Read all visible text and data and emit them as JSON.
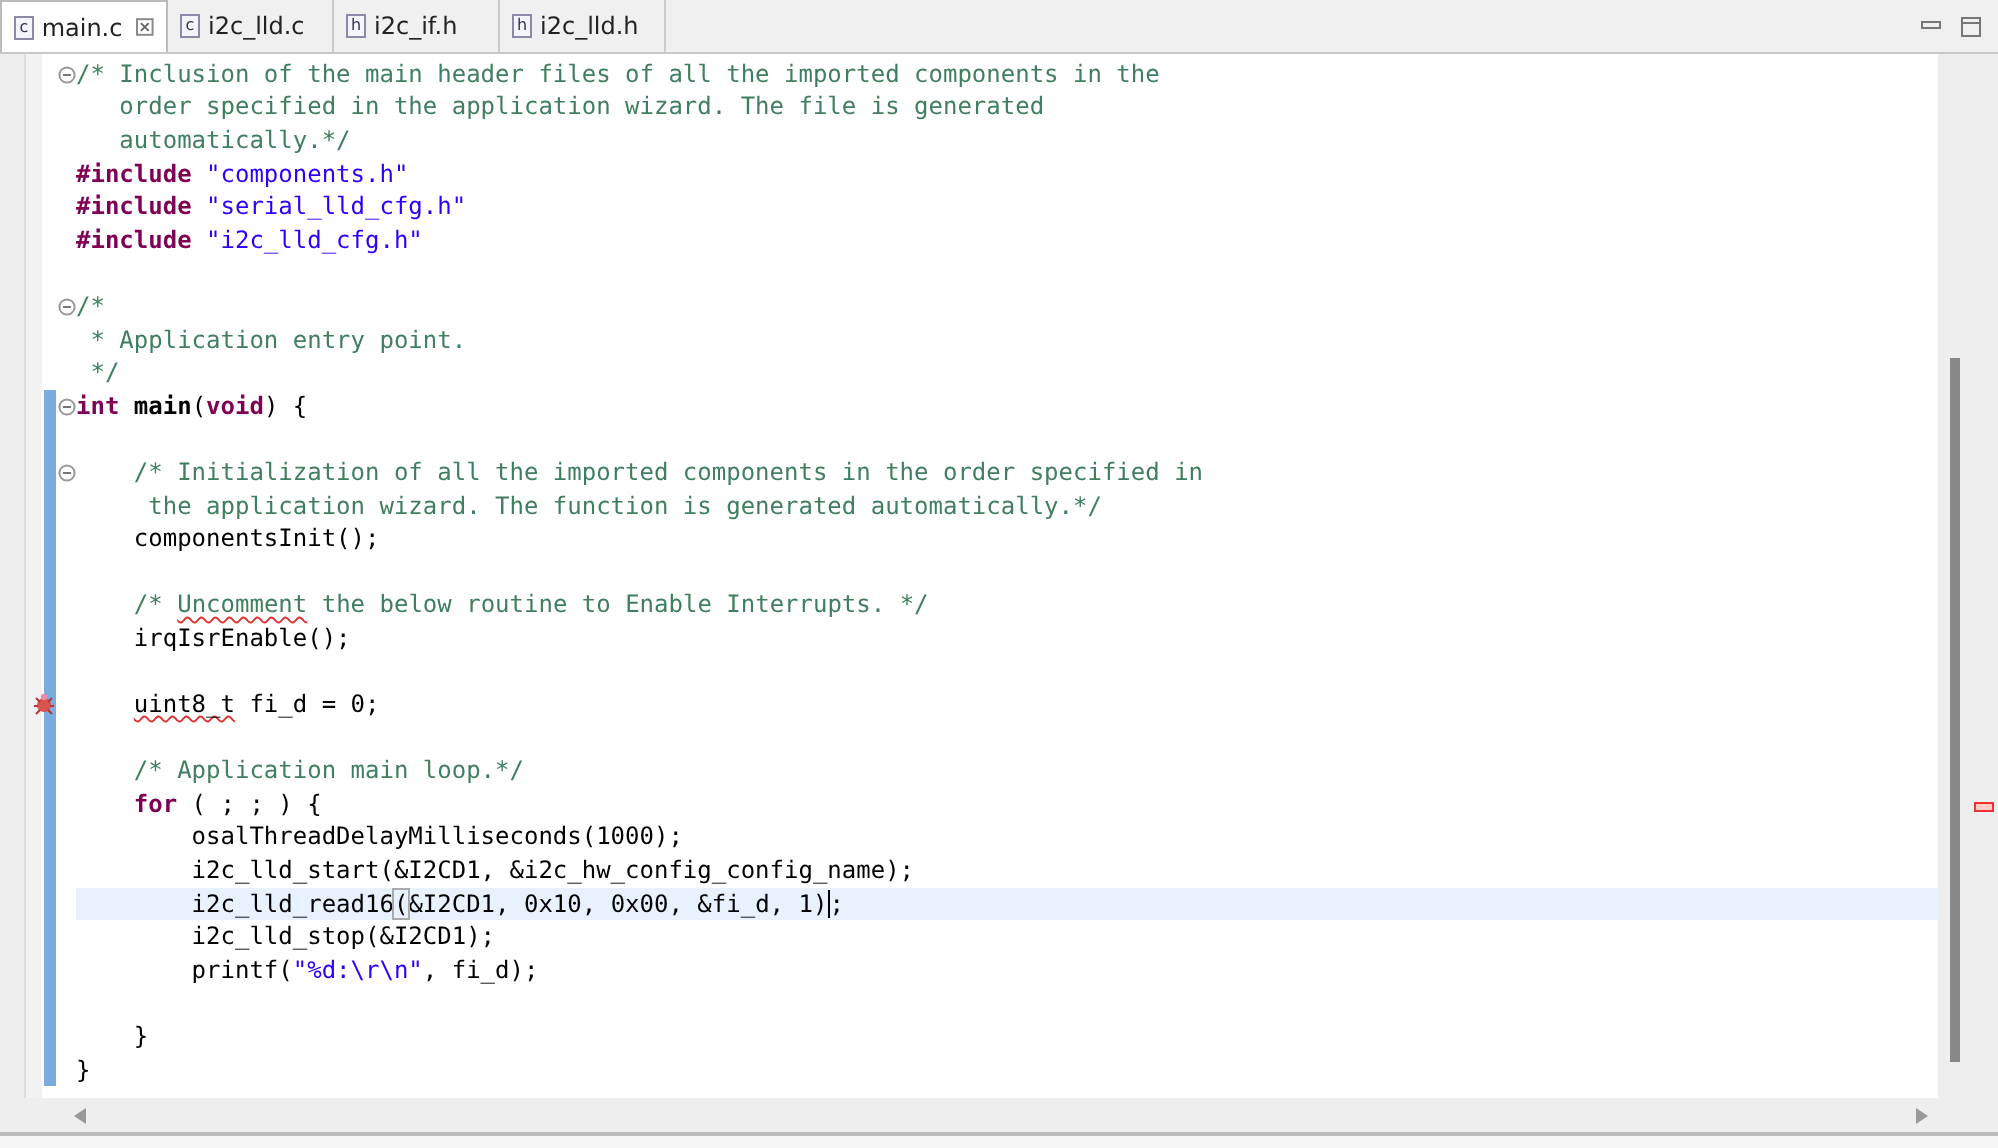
{
  "tabs": [
    {
      "label": "main.c",
      "icon_letter": "c",
      "selected": true
    },
    {
      "label": "i2c_lld.c",
      "icon_letter": "c",
      "selected": false
    },
    {
      "label": "i2c_if.h",
      "icon_letter": "h",
      "selected": false
    },
    {
      "label": "i2c_lld.h",
      "icon_letter": "h",
      "selected": false
    }
  ],
  "editor": {
    "lines": [
      {
        "fold": true,
        "problem": false,
        "changed": false,
        "current": false,
        "tokens": [
          {
            "kind": "comment",
            "text": "/* Inclusion of the main header files of all the imported components in the"
          }
        ]
      },
      {
        "fold": false,
        "problem": false,
        "changed": false,
        "current": false,
        "tokens": [
          {
            "kind": "comment",
            "text": "   order specified in the application wizard. The file is generated"
          }
        ]
      },
      {
        "fold": false,
        "problem": false,
        "changed": false,
        "current": false,
        "tokens": [
          {
            "kind": "comment",
            "text": "   automatically.*/"
          }
        ]
      },
      {
        "fold": false,
        "problem": false,
        "changed": false,
        "current": false,
        "tokens": [
          {
            "kind": "keyword",
            "text": "#include"
          },
          {
            "kind": "string",
            "text": " \"components.h\""
          }
        ]
      },
      {
        "fold": false,
        "problem": false,
        "changed": false,
        "current": false,
        "tokens": [
          {
            "kind": "keyword",
            "text": "#include"
          },
          {
            "kind": "string",
            "text": " \"serial_lld_cfg.h\""
          }
        ]
      },
      {
        "fold": false,
        "problem": false,
        "changed": false,
        "current": false,
        "tokens": [
          {
            "kind": "keyword",
            "text": "#include"
          },
          {
            "kind": "string",
            "text": " \"i2c_lld_cfg.h\""
          }
        ]
      },
      {
        "changed": false,
        "current": false
      },
      {
        "fold": true,
        "problem": false,
        "changed": false,
        "current": false,
        "tokens": [
          {
            "kind": "comment",
            "text": "/*"
          }
        ]
      },
      {
        "fold": false,
        "problem": false,
        "changed": false,
        "current": false,
        "tokens": [
          {
            "kind": "comment",
            "text": " * Application entry point."
          }
        ]
      },
      {
        "fold": false,
        "problem": false,
        "changed": false,
        "current": false,
        "tokens": [
          {
            "kind": "comment",
            "text": " */"
          }
        ]
      },
      {
        "fold": true,
        "problem": false,
        "changed": true,
        "current": false,
        "tokens": [
          {
            "kind": "keyword",
            "text": "int"
          },
          {
            "kind": "function",
            "text": " main"
          },
          {
            "kind": "plain",
            "text": "("
          },
          {
            "kind": "keyword",
            "text": "void"
          },
          {
            "kind": "plain",
            "text": ") {"
          }
        ]
      },
      {
        "changed": true,
        "current": false
      },
      {
        "fold": true,
        "problem": false,
        "changed": true,
        "current": false,
        "tokens": [
          {
            "kind": "comment",
            "text": "    /* Initialization of all the imported components in the order specified in"
          }
        ]
      },
      {
        "fold": false,
        "problem": false,
        "changed": true,
        "current": false,
        "tokens": [
          {
            "kind": "comment",
            "text": "     the application wizard. The function is generated automatically.*/"
          }
        ]
      },
      {
        "fold": false,
        "problem": false,
        "changed": true,
        "current": false,
        "tokens": [
          {
            "kind": "plain",
            "text": "    componentsInit();"
          }
        ]
      },
      {
        "changed": true,
        "current": false
      },
      {
        "fold": false,
        "problem": false,
        "changed": true,
        "current": false,
        "tokens": [
          {
            "kind": "comment",
            "text": "    /*"
          },
          {
            "kind": "comment",
            "text": " Uncomment",
            "misspelled": true
          },
          {
            "kind": "comment",
            "text": " the below routine to Enable Interrupts. */"
          }
        ]
      },
      {
        "fold": false,
        "problem": false,
        "changed": true,
        "current": false,
        "tokens": [
          {
            "kind": "plain",
            "text": "    irqIsrEnable();"
          }
        ]
      },
      {
        "changed": true,
        "current": false
      },
      {
        "fold": false,
        "problem": true,
        "changed": true,
        "current": false,
        "tokens": [
          {
            "kind": "plain",
            "text": "    uint8_t",
            "misspelled": true
          },
          {
            "kind": "plain",
            "text": " fi_d = 0;"
          }
        ]
      },
      {
        "changed": true,
        "current": false
      },
      {
        "fold": false,
        "problem": false,
        "changed": true,
        "current": false,
        "tokens": [
          {
            "kind": "comment",
            "text": "    /* Application main loop.*/"
          }
        ]
      },
      {
        "fold": false,
        "problem": false,
        "changed": true,
        "current": false,
        "tokens": [
          {
            "kind": "keyword",
            "text": "    for"
          },
          {
            "kind": "plain",
            "text": " ( ; ; ) {"
          }
        ]
      },
      {
        "fold": false,
        "problem": false,
        "changed": true,
        "current": false,
        "tokens": [
          {
            "kind": "plain",
            "text": "        osalThreadDelayMilliseconds(1000);"
          }
        ]
      },
      {
        "fold": false,
        "problem": false,
        "changed": true,
        "current": false,
        "tokens": [
          {
            "kind": "plain",
            "text": "        i2c_lld_start(&I2CD1, &i2c_hw_config_config_name);"
          }
        ]
      },
      {
        "fold": false,
        "problem": false,
        "changed": true,
        "current": true,
        "tokens": [
          {
            "kind": "plain",
            "text": "        i2c_lld_read16"
          },
          {
            "kind": "plain",
            "text": "(",
            "matched": true
          },
          {
            "kind": "plain",
            "text": "&I2CD1, 0x10, 0x00, &fi_d, 1)"
          },
          {
            "kind": "plain",
            "text": ";",
            "caret_before": true
          }
        ]
      },
      {
        "fold": false,
        "problem": false,
        "changed": true,
        "current": false,
        "tokens": [
          {
            "kind": "plain",
            "text": "        i2c_lld_stop(&I2CD1);"
          }
        ]
      },
      {
        "fold": false,
        "problem": false,
        "changed": true,
        "current": false,
        "tokens": [
          {
            "kind": "plain",
            "text": "        printf("
          },
          {
            "kind": "string",
            "text": "\"%d:\\r\\n\""
          },
          {
            "kind": "plain",
            "text": ", fi_d);"
          }
        ]
      },
      {
        "changed": true,
        "current": false
      },
      {
        "fold": false,
        "problem": false,
        "changed": true,
        "current": false,
        "tokens": [
          {
            "kind": "plain",
            "text": "    }"
          }
        ]
      },
      {
        "fold": false,
        "problem": false,
        "changed": true,
        "current": false,
        "tokens": [
          {
            "kind": "plain",
            "text": "}"
          }
        ]
      }
    ]
  }
}
